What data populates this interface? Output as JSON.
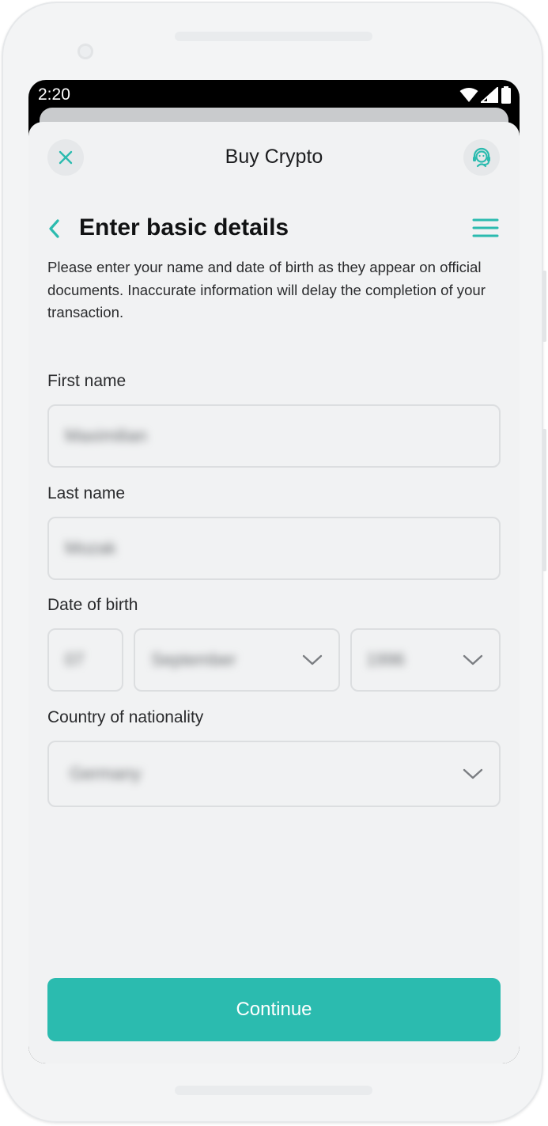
{
  "status_bar": {
    "time": "2:20"
  },
  "header": {
    "title": "Buy Crypto",
    "close_icon": "close-icon",
    "support_icon": "support-agent-icon"
  },
  "page": {
    "title": "Enter basic details",
    "back_icon": "chevron-left-icon",
    "menu_icon": "hamburger-menu-icon",
    "description": "Please enter your name and date of birth as they appear on official documents. Inaccurate information will delay the completion of your transaction."
  },
  "form": {
    "first_name": {
      "label": "First name",
      "value": "Maximilian"
    },
    "last_name": {
      "label": "Last name",
      "value": "Mozak"
    },
    "dob": {
      "label": "Date of birth",
      "day": "07",
      "month": "September",
      "year": "1996"
    },
    "nationality": {
      "label": "Country of nationality",
      "value": "Germany"
    }
  },
  "continue_label": "Continue",
  "colors": {
    "accent": "#2bbbaf",
    "background": "#f1f2f3",
    "text": "#111213"
  }
}
